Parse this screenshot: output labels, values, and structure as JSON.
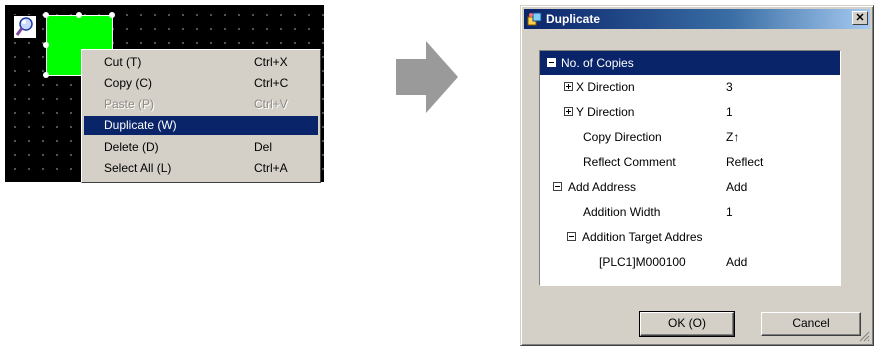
{
  "context_menu": {
    "items": [
      {
        "label": "Cut (T)",
        "shortcut": "Ctrl+X",
        "state": "normal"
      },
      {
        "label": "Copy (C)",
        "shortcut": "Ctrl+C",
        "state": "normal"
      },
      {
        "label": "Paste (P)",
        "shortcut": "Ctrl+V",
        "state": "disabled"
      },
      {
        "label": "Duplicate (W)",
        "shortcut": "",
        "state": "selected"
      },
      {
        "label": "Delete (D)",
        "shortcut": "Del",
        "state": "normal"
      },
      {
        "label": "Select All (L)",
        "shortcut": "Ctrl+A",
        "state": "normal"
      }
    ]
  },
  "dialog": {
    "title": "Duplicate",
    "close_glyph": "✕",
    "properties": {
      "header": "No. of Copies",
      "x_direction": {
        "label": "X Direction",
        "value": "3"
      },
      "y_direction": {
        "label": "Y Direction",
        "value": "1"
      },
      "copy_direction": {
        "label": "Copy Direction",
        "value": "Z↑"
      },
      "reflect_comment": {
        "label": "Reflect Comment",
        "value": "Reflect"
      },
      "add_address": {
        "label": "Add Address",
        "value": "Add"
      },
      "addition_width": {
        "label": "Addition Width",
        "value": "1"
      },
      "addition_target": {
        "label": "Addition Target Addres"
      },
      "plc_address": {
        "label": "[PLC1]M000100",
        "value": "Add"
      }
    },
    "ok_label": "OK (O)",
    "cancel_label": "Cancel"
  },
  "colors": {
    "selection": "#0a246a",
    "shape_fill": "#00ff00",
    "face": "#d4d0c8"
  }
}
